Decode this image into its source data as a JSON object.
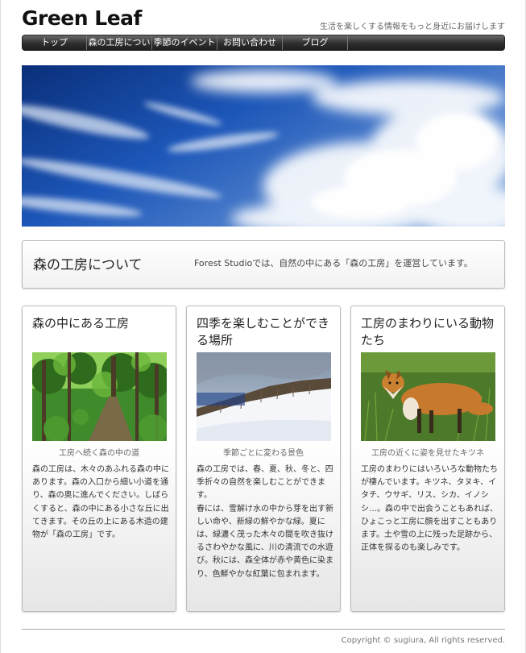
{
  "header": {
    "logo": "Green Leaf",
    "tagline": "生活を楽しくする情報をもっと身近にお届けします"
  },
  "nav": {
    "items": [
      {
        "label": "トップ"
      },
      {
        "label": "森の工房につい"
      },
      {
        "label": "季節のイベント"
      },
      {
        "label": "お問い合わせ"
      },
      {
        "label": "ブログ"
      }
    ]
  },
  "intro": {
    "title": "森の工房について",
    "text": "Forest Studioでは、自然の中にある「森の工房」を運営しています。"
  },
  "cards": [
    {
      "title": "森の中にある工房",
      "caption": "工房へ続く森の中の道",
      "body": "森の工房は、木々のあふれる森の中にあります。森の入口から細い小道を通り、森の奥に進んでください。しばらくすると、森の中にある小さな丘に出てきます。その丘の上にある木造の建物が「森の工房」です。"
    },
    {
      "title": "四季を楽しむことができる場所",
      "caption": "季節ごとに変わる景色",
      "body": "森の工房では、春、夏、秋、冬と、四季折々の自然を楽しむことができます。\n春には、雪解け水の中から芽を出す新しい命や、新緑の鮮やかな緑。夏には、緑濃く茂った木々の間を吹き抜けるさわやかな風に、川の清流での水遊び。秋には、森全体が赤や黄色に染まり、色鮮やかな紅葉に包まれます。"
    },
    {
      "title": "工房のまわりにいる動物たち",
      "caption": "工房の近くに姿を見せたキツネ",
      "body": "工房のまわりにはいろいろな動物たちが棲んでいます。キツネ、タヌキ、イタチ、ウサギ、リス、シカ、イノシシ…。森の中で出会うこともあれば、ひょこっと工房に顔を出すこともあります。土や雪の上に残った足跡から、正体を探るのも楽しみです。"
    }
  ],
  "footer": {
    "copyright": "Copyright © sugiura, All rights reserved."
  },
  "colors": {
    "nav_bg": "#2e2e2e",
    "sky_blue": "#1f4fa8"
  }
}
